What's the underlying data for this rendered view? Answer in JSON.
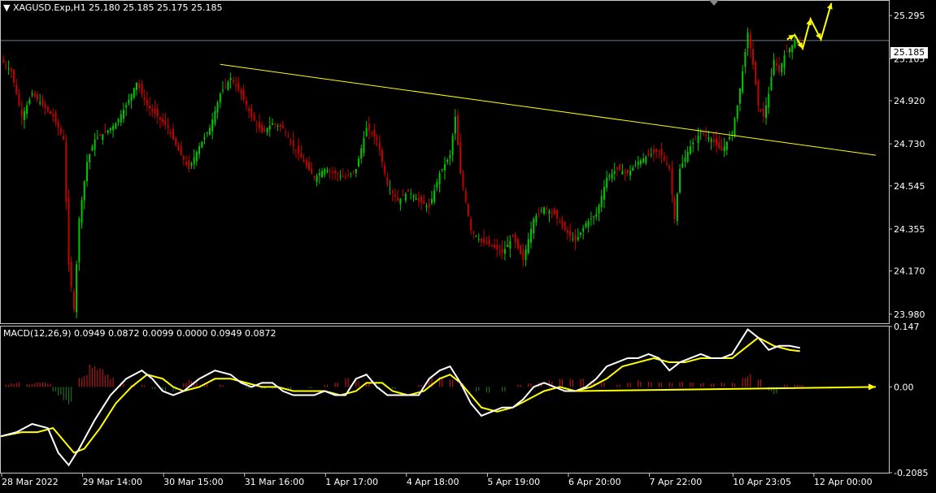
{
  "header": {
    "symbol_label": "XAGUSD.Exp,H1",
    "ohlc_label": "25.180 25.185 25.175 25.185"
  },
  "current_price": {
    "label": "25.185",
    "value": 25.185
  },
  "macd_header": {
    "label": "MACD(12,26,9) 0.0949 0.0872 0.0099 0.0000 0.0949 0.0872"
  },
  "colors": {
    "background": "#000000",
    "bull_candle": "#00c800",
    "bear_candle": "#c80000",
    "trendline": "#ffff00",
    "macd_line": "#ffffff",
    "signal_line": "#ffff00",
    "hist_positive": "#b01818",
    "hist_negative": "#1e6e1e",
    "forecast_arrow": "#ffff00"
  },
  "chart_data": [
    {
      "type": "candlestick",
      "title": "XAGUSD.Exp,H1",
      "ylim": [
        23.94,
        25.36
      ],
      "y_ticks": [
        "25.295",
        "25.105",
        "24.920",
        "24.730",
        "24.545",
        "24.355",
        "24.170",
        "23.980"
      ],
      "y_tick_values": [
        25.295,
        25.105,
        24.92,
        24.73,
        24.545,
        24.355,
        24.17,
        23.98
      ],
      "x_ticks": [
        "28 Mar 2022",
        "29 Mar 14:00",
        "30 Mar 15:00",
        "31 Mar 16:00",
        "1 Apr 17:00",
        "4 Apr 18:00",
        "5 Apr 19:00",
        "6 Apr 20:00",
        "7 Apr 22:00",
        "10 Apr 23:05",
        "12 Apr 00:00"
      ],
      "close_path": [
        [
          0,
          25.1
        ],
        [
          4,
          25.05
        ],
        [
          8,
          24.85
        ],
        [
          12,
          24.95
        ],
        [
          16,
          24.9
        ],
        [
          20,
          24.85
        ],
        [
          24,
          24.75
        ],
        [
          26,
          24.2
        ],
        [
          28,
          24.0
        ],
        [
          30,
          24.4
        ],
        [
          33,
          24.65
        ],
        [
          36,
          24.75
        ],
        [
          40,
          24.78
        ],
        [
          44,
          24.82
        ],
        [
          48,
          24.9
        ],
        [
          52,
          25.0
        ],
        [
          56,
          24.9
        ],
        [
          60,
          24.85
        ],
        [
          64,
          24.8
        ],
        [
          68,
          24.7
        ],
        [
          72,
          24.62
        ],
        [
          76,
          24.72
        ],
        [
          80,
          24.8
        ],
        [
          84,
          24.95
        ],
        [
          88,
          25.02
        ],
        [
          92,
          24.95
        ],
        [
          96,
          24.85
        ],
        [
          100,
          24.78
        ],
        [
          104,
          24.82
        ],
        [
          108,
          24.8
        ],
        [
          112,
          24.72
        ],
        [
          116,
          24.65
        ],
        [
          120,
          24.58
        ],
        [
          124,
          24.62
        ],
        [
          128,
          24.6
        ],
        [
          132,
          24.58
        ],
        [
          136,
          24.62
        ],
        [
          140,
          24.8
        ],
        [
          144,
          24.75
        ],
        [
          148,
          24.55
        ],
        [
          152,
          24.48
        ],
        [
          156,
          24.52
        ],
        [
          160,
          24.48
        ],
        [
          164,
          24.45
        ],
        [
          168,
          24.6
        ],
        [
          172,
          24.68
        ],
        [
          174,
          24.85
        ],
        [
          176,
          24.6
        ],
        [
          180,
          24.35
        ],
        [
          184,
          24.3
        ],
        [
          188,
          24.28
        ],
        [
          192,
          24.25
        ],
        [
          196,
          24.32
        ],
        [
          200,
          24.22
        ],
        [
          204,
          24.4
        ],
        [
          208,
          24.45
        ],
        [
          212,
          24.42
        ],
        [
          216,
          24.35
        ],
        [
          220,
          24.3
        ],
        [
          224,
          24.38
        ],
        [
          228,
          24.42
        ],
        [
          232,
          24.58
        ],
        [
          236,
          24.62
        ],
        [
          240,
          24.6
        ],
        [
          244,
          24.65
        ],
        [
          248,
          24.68
        ],
        [
          252,
          24.7
        ],
        [
          256,
          24.62
        ],
        [
          258,
          24.4
        ],
        [
          260,
          24.62
        ],
        [
          264,
          24.72
        ],
        [
          268,
          24.78
        ],
        [
          272,
          24.75
        ],
        [
          276,
          24.7
        ],
        [
          280,
          24.78
        ],
        [
          282,
          24.9
        ],
        [
          284,
          25.05
        ],
        [
          286,
          25.22
        ],
        [
          288,
          25.08
        ],
        [
          290,
          24.9
        ],
        [
          292,
          24.85
        ],
        [
          294,
          24.95
        ],
        [
          296,
          25.1
        ],
        [
          298,
          25.05
        ],
        [
          300,
          25.12
        ],
        [
          302,
          25.15
        ],
        [
          304,
          25.18
        ],
        [
          306,
          25.185
        ]
      ],
      "trendline": [
        [
          84,
          25.08
        ],
        [
          335,
          24.68
        ]
      ],
      "forecast_path": [
        [
          301,
          25.19
        ],
        [
          304,
          25.21
        ],
        [
          307,
          25.15
        ],
        [
          310,
          25.28
        ],
        [
          314,
          25.19
        ],
        [
          318,
          25.35
        ]
      ]
    },
    {
      "type": "macd",
      "title": "MACD(12,26,9)",
      "ylim": [
        -0.2085,
        0.147
      ],
      "y_ticks": [
        "0.147",
        "0.00",
        "-0.2085"
      ],
      "y_tick_values": [
        0.147,
        0.0,
        -0.2085
      ],
      "macd_path": [
        [
          0,
          -0.12
        ],
        [
          6,
          -0.11
        ],
        [
          12,
          -0.09
        ],
        [
          18,
          -0.1
        ],
        [
          22,
          -0.16
        ],
        [
          26,
          -0.19
        ],
        [
          30,
          -0.15
        ],
        [
          36,
          -0.08
        ],
        [
          42,
          -0.02
        ],
        [
          48,
          0.02
        ],
        [
          54,
          0.04
        ],
        [
          58,
          0.02
        ],
        [
          62,
          -0.01
        ],
        [
          66,
          -0.02
        ],
        [
          70,
          -0.01
        ],
        [
          76,
          0.02
        ],
        [
          82,
          0.04
        ],
        [
          88,
          0.03
        ],
        [
          92,
          0.01
        ],
        [
          96,
          0.0
        ],
        [
          100,
          0.01
        ],
        [
          104,
          0.01
        ],
        [
          108,
          -0.01
        ],
        [
          112,
          -0.02
        ],
        [
          116,
          -0.02
        ],
        [
          120,
          -0.02
        ],
        [
          124,
          -0.01
        ],
        [
          128,
          -0.02
        ],
        [
          132,
          -0.02
        ],
        [
          136,
          0.02
        ],
        [
          140,
          0.03
        ],
        [
          144,
          0.0
        ],
        [
          148,
          -0.02
        ],
        [
          152,
          -0.02
        ],
        [
          156,
          -0.02
        ],
        [
          160,
          -0.02
        ],
        [
          164,
          0.02
        ],
        [
          168,
          0.04
        ],
        [
          172,
          0.05
        ],
        [
          176,
          0.01
        ],
        [
          180,
          -0.04
        ],
        [
          184,
          -0.07
        ],
        [
          188,
          -0.06
        ],
        [
          192,
          -0.05
        ],
        [
          196,
          -0.05
        ],
        [
          200,
          -0.03
        ],
        [
          204,
          0.0
        ],
        [
          208,
          0.01
        ],
        [
          212,
          0.0
        ],
        [
          216,
          -0.01
        ],
        [
          220,
          -0.01
        ],
        [
          224,
          0.0
        ],
        [
          228,
          0.02
        ],
        [
          232,
          0.05
        ],
        [
          236,
          0.06
        ],
        [
          240,
          0.07
        ],
        [
          244,
          0.07
        ],
        [
          248,
          0.08
        ],
        [
          252,
          0.07
        ],
        [
          256,
          0.04
        ],
        [
          260,
          0.06
        ],
        [
          264,
          0.07
        ],
        [
          268,
          0.08
        ],
        [
          272,
          0.07
        ],
        [
          276,
          0.07
        ],
        [
          280,
          0.08
        ],
        [
          284,
          0.12
        ],
        [
          286,
          0.14
        ],
        [
          290,
          0.12
        ],
        [
          294,
          0.09
        ],
        [
          298,
          0.1
        ],
        [
          302,
          0.1
        ],
        [
          306,
          0.095
        ]
      ],
      "signal_path": [
        [
          0,
          -0.12
        ],
        [
          8,
          -0.11
        ],
        [
          14,
          -0.11
        ],
        [
          20,
          -0.1
        ],
        [
          24,
          -0.13
        ],
        [
          28,
          -0.16
        ],
        [
          32,
          -0.15
        ],
        [
          38,
          -0.1
        ],
        [
          44,
          -0.04
        ],
        [
          50,
          0.0
        ],
        [
          56,
          0.03
        ],
        [
          62,
          0.02
        ],
        [
          66,
          0.0
        ],
        [
          70,
          -0.01
        ],
        [
          76,
          0.0
        ],
        [
          82,
          0.02
        ],
        [
          88,
          0.02
        ],
        [
          94,
          0.01
        ],
        [
          100,
          0.0
        ],
        [
          106,
          0.0
        ],
        [
          112,
          -0.01
        ],
        [
          118,
          -0.01
        ],
        [
          124,
          -0.01
        ],
        [
          130,
          -0.02
        ],
        [
          136,
          -0.01
        ],
        [
          140,
          0.01
        ],
        [
          146,
          0.01
        ],
        [
          150,
          -0.01
        ],
        [
          156,
          -0.02
        ],
        [
          162,
          -0.01
        ],
        [
          168,
          0.02
        ],
        [
          172,
          0.03
        ],
        [
          176,
          0.01
        ],
        [
          180,
          -0.02
        ],
        [
          184,
          -0.05
        ],
        [
          190,
          -0.06
        ],
        [
          196,
          -0.05
        ],
        [
          202,
          -0.03
        ],
        [
          208,
          -0.01
        ],
        [
          214,
          0.0
        ],
        [
          220,
          -0.01
        ],
        [
          226,
          0.0
        ],
        [
          232,
          0.02
        ],
        [
          238,
          0.05
        ],
        [
          244,
          0.06
        ],
        [
          250,
          0.07
        ],
        [
          256,
          0.06
        ],
        [
          262,
          0.06
        ],
        [
          268,
          0.07
        ],
        [
          274,
          0.07
        ],
        [
          280,
          0.07
        ],
        [
          286,
          0.1
        ],
        [
          290,
          0.12
        ],
        [
          296,
          0.1
        ],
        [
          302,
          0.09
        ],
        [
          306,
          0.087
        ]
      ],
      "histogram": [
        [
          2,
          0.005
        ],
        [
          4,
          0.008
        ],
        [
          6,
          0.01
        ],
        [
          10,
          0.006
        ],
        [
          12,
          0.008
        ],
        [
          14,
          0.01
        ],
        [
          16,
          0.012
        ],
        [
          18,
          0.008
        ],
        [
          20,
          -0.01
        ],
        [
          22,
          -0.02
        ],
        [
          24,
          -0.03
        ],
        [
          26,
          -0.04
        ],
        [
          30,
          0.02
        ],
        [
          32,
          0.03
        ],
        [
          34,
          0.05
        ],
        [
          36,
          0.045
        ],
        [
          38,
          0.04
        ],
        [
          40,
          0.03
        ],
        [
          42,
          0.02
        ],
        [
          46,
          0.01
        ],
        [
          50,
          0.005
        ],
        [
          54,
          0.005
        ],
        [
          58,
          -0.005
        ],
        [
          62,
          -0.01
        ],
        [
          66,
          -0.01
        ],
        [
          70,
          0.01
        ],
        [
          72,
          0.015
        ],
        [
          74,
          0.012
        ],
        [
          78,
          0.01
        ],
        [
          84,
          0.005
        ],
        [
          94,
          -0.005
        ],
        [
          100,
          -0.005
        ],
        [
          104,
          -0.005
        ],
        [
          110,
          -0.005
        ],
        [
          118,
          -0.003
        ],
        [
          124,
          0.005
        ],
        [
          128,
          0.01
        ],
        [
          132,
          0.02
        ],
        [
          136,
          0.015
        ],
        [
          140,
          0.01
        ],
        [
          144,
          -0.005
        ],
        [
          150,
          -0.005
        ],
        [
          160,
          0.005
        ],
        [
          164,
          0.02
        ],
        [
          168,
          0.025
        ],
        [
          172,
          0.02
        ],
        [
          176,
          0.01
        ],
        [
          182,
          -0.01
        ],
        [
          186,
          -0.015
        ],
        [
          192,
          -0.01
        ],
        [
          198,
          0.005
        ],
        [
          202,
          0.01
        ],
        [
          206,
          0.01
        ],
        [
          210,
          0.015
        ],
        [
          214,
          0.02
        ],
        [
          218,
          0.02
        ],
        [
          222,
          0.018
        ],
        [
          226,
          0.015
        ],
        [
          230,
          0.01
        ],
        [
          236,
          0.005
        ],
        [
          240,
          0.01
        ],
        [
          244,
          0.015
        ],
        [
          248,
          0.012
        ],
        [
          252,
          0.01
        ],
        [
          256,
          0.01
        ],
        [
          260,
          0.012
        ],
        [
          264,
          0.01
        ],
        [
          268,
          0.01
        ],
        [
          272,
          0.008
        ],
        [
          276,
          0.01
        ],
        [
          280,
          0.01
        ],
        [
          284,
          0.02
        ],
        [
          286,
          0.03
        ],
        [
          290,
          0.02
        ],
        [
          294,
          -0.01
        ],
        [
          296,
          -0.015
        ],
        [
          300,
          0.005
        ],
        [
          304,
          0.005
        ],
        [
          306,
          0.004
        ]
      ],
      "forecast_arrow": [
        [
          0,
          -0.01
        ],
        [
          335,
          0.0
        ]
      ]
    }
  ]
}
